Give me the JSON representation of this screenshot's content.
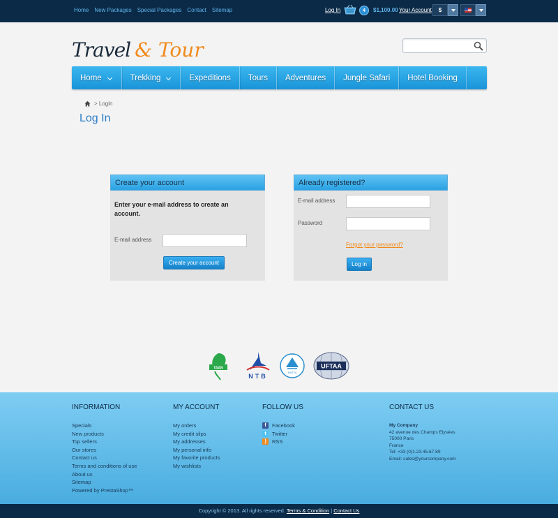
{
  "topbar": {
    "links": [
      "Home",
      "New Packages",
      "Special Packages",
      "Contact",
      "Sitemap"
    ],
    "login": "Log In",
    "cart_count": "4",
    "cart_total": "$1,100.00",
    "account": "Your Account",
    "currency": "$"
  },
  "logo": {
    "part1": "Travel",
    "part2": "& Tour"
  },
  "search": {
    "placeholder": ""
  },
  "nav": [
    {
      "label": "Home",
      "dropdown": true
    },
    {
      "label": "Trekking",
      "dropdown": true
    },
    {
      "label": "Expeditions",
      "dropdown": false
    },
    {
      "label": "Tours",
      "dropdown": false
    },
    {
      "label": "Adventures",
      "dropdown": false
    },
    {
      "label": "Jungle Safari",
      "dropdown": false
    },
    {
      "label": "Hotel Booking",
      "dropdown": false
    }
  ],
  "breadcrumb": {
    "current": "> Login"
  },
  "page_title": "Log In",
  "create": {
    "title": "Create your account",
    "text_line1": "Enter your e-mail address to create an",
    "text_line2": "account.",
    "email_label": "E-mail address",
    "button": "Create your account"
  },
  "login": {
    "title": "Already registered?",
    "email_label": "E-mail address",
    "password_label": "Password",
    "forgot": "Forgot your password?",
    "button": "Log in"
  },
  "partners": [
    "TAAN",
    "NTB",
    "NATTA",
    "UFTAA"
  ],
  "footer": {
    "information": {
      "title": "INFORMATION",
      "items": [
        "Specials",
        "New products",
        "Top sellers",
        "Our stores",
        "Contact us",
        "Terms and conditions of use",
        "About us",
        "Sitemap",
        "Powered by PrestaShop™"
      ]
    },
    "account": {
      "title": "MY ACCOUNT",
      "items": [
        "My orders",
        "My credit slips",
        "My addresses",
        "My personal info",
        "My favorite products",
        "My wishlists"
      ]
    },
    "follow": {
      "title": "FOLLOW US",
      "items": [
        "Facebook",
        "Twitter",
        "RSS"
      ]
    },
    "contact": {
      "title": "CONTACT US",
      "company": "My Company",
      "line1": "42 avenue des Champs Elysées",
      "line2": "75000 Paris",
      "line3": "France",
      "phone": "Tel: +33 (0)1.23.45.67.89",
      "email": "Email: sales@yourcompany.com"
    }
  },
  "bottom": {
    "copyright": "Copyright © 2013. All rights reserved.",
    "terms": "Terms & Condition",
    "sep": "|",
    "contact": "Contact Us"
  },
  "colors": {
    "dark": "#0a2a48",
    "accent": "#2aa2e4",
    "orange": "#f08a1c"
  }
}
